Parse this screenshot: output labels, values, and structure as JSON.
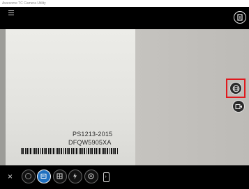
{
  "window": {
    "title": "Awesome TC Camera Utility"
  },
  "viewfinder": {
    "label_line1": "PS1213-2015",
    "label_line2": "DFQW5905XA"
  },
  "icons": {
    "menu": "hamburger-menu-icon",
    "top_right": "info-icon",
    "scan_mode": "scan-mode-icon",
    "video": "video-icon",
    "close": "close-icon",
    "bottom": [
      "photo-icon",
      "barcode-scan-icon",
      "grid-icon",
      "flash-icon",
      "effects-icon",
      "more-icon"
    ]
  },
  "colors": {
    "highlight": "#e0191e",
    "active": "#1f6fbf"
  },
  "bottom_bar": {
    "close_glyph": "×",
    "more_glyph": "›"
  }
}
